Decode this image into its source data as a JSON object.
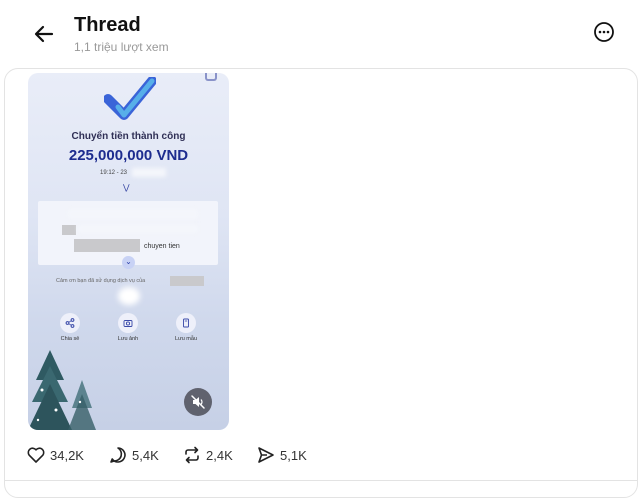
{
  "header": {
    "title": "Thread",
    "views": "1,1 triệu lượt xem"
  },
  "post": {
    "media": {
      "success_label": "Chuyển tiền thành công",
      "amount": "225,000,000 VND",
      "time": "19:12 - 23",
      "transfer_note": "chuyen tien",
      "thanks_text": "Cảm ơn bạn đã sử dụng dịch vụ của",
      "actions": [
        {
          "label": "Chia sẻ",
          "icon": "share-icon"
        },
        {
          "label": "Lưu ảnh",
          "icon": "camera-icon"
        },
        {
          "label": "Lưu mẫu",
          "icon": "bookmark-icon"
        }
      ]
    },
    "stats": {
      "likes": "34,2K",
      "replies": "5,4K",
      "reposts": "2,4K",
      "shares": "5,1K"
    }
  },
  "colors": {
    "accent": "#1d2c8f",
    "text": "#101010",
    "muted": "#999999",
    "border": "#e3e3e3"
  }
}
